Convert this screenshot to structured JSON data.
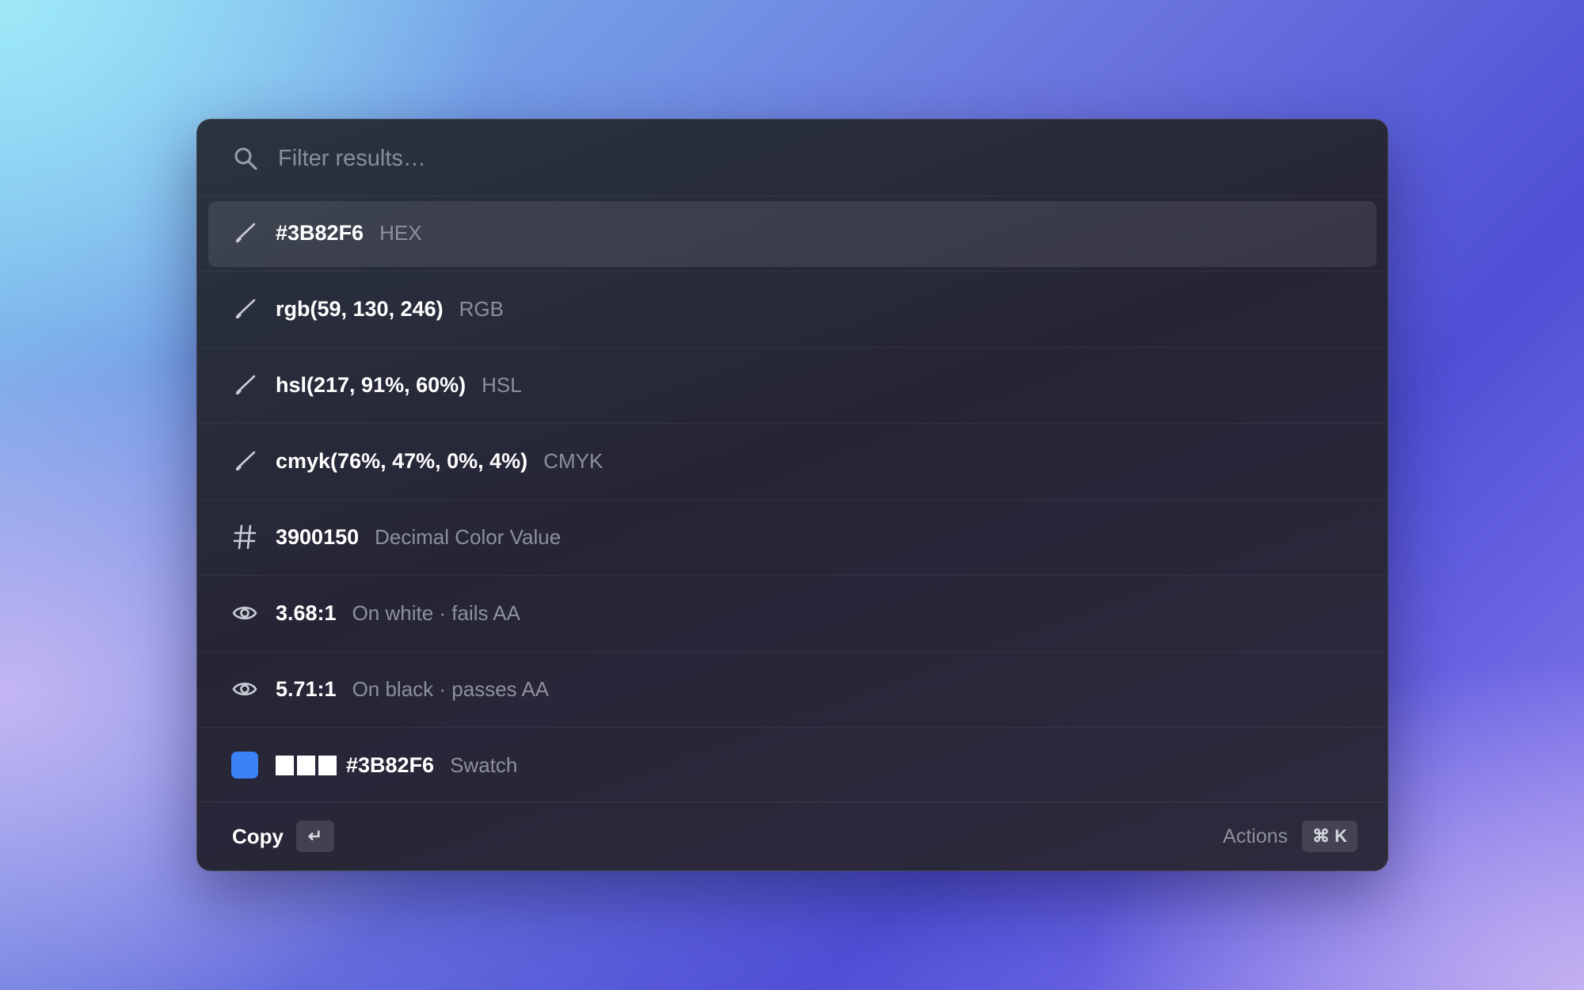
{
  "search": {
    "placeholder": "Filter results…",
    "value": ""
  },
  "results": [
    {
      "icon": "eyedropper-icon",
      "primary": "#3B82F6",
      "secondary": "HEX",
      "selected": true
    },
    {
      "icon": "eyedropper-icon",
      "primary": "rgb(59, 130, 246)",
      "secondary": "RGB"
    },
    {
      "icon": "eyedropper-icon",
      "primary": "hsl(217, 91%, 60%)",
      "secondary": "HSL"
    },
    {
      "icon": "eyedropper-icon",
      "primary": "cmyk(76%, 47%, 0%, 4%)",
      "secondary": "CMYK"
    },
    {
      "icon": "hash-icon",
      "primary": "3900150",
      "secondary": "Decimal Color Value"
    },
    {
      "icon": "eye-icon",
      "primary": "3.68:1",
      "secondary": "On white · fails AA"
    },
    {
      "icon": "eye-icon",
      "primary": "5.71:1",
      "secondary": "On black · passes AA"
    },
    {
      "icon": "color-swatch-icon",
      "primary": "#3B82F6",
      "secondary": "Swatch",
      "swatch_color": "#3B82F6"
    }
  ],
  "footer": {
    "primary_action": "Copy",
    "primary_shortcut": "↵",
    "actions_label": "Actions",
    "actions_shortcut": "⌘ K"
  },
  "colors": {
    "swatch": "#3B82F6"
  }
}
